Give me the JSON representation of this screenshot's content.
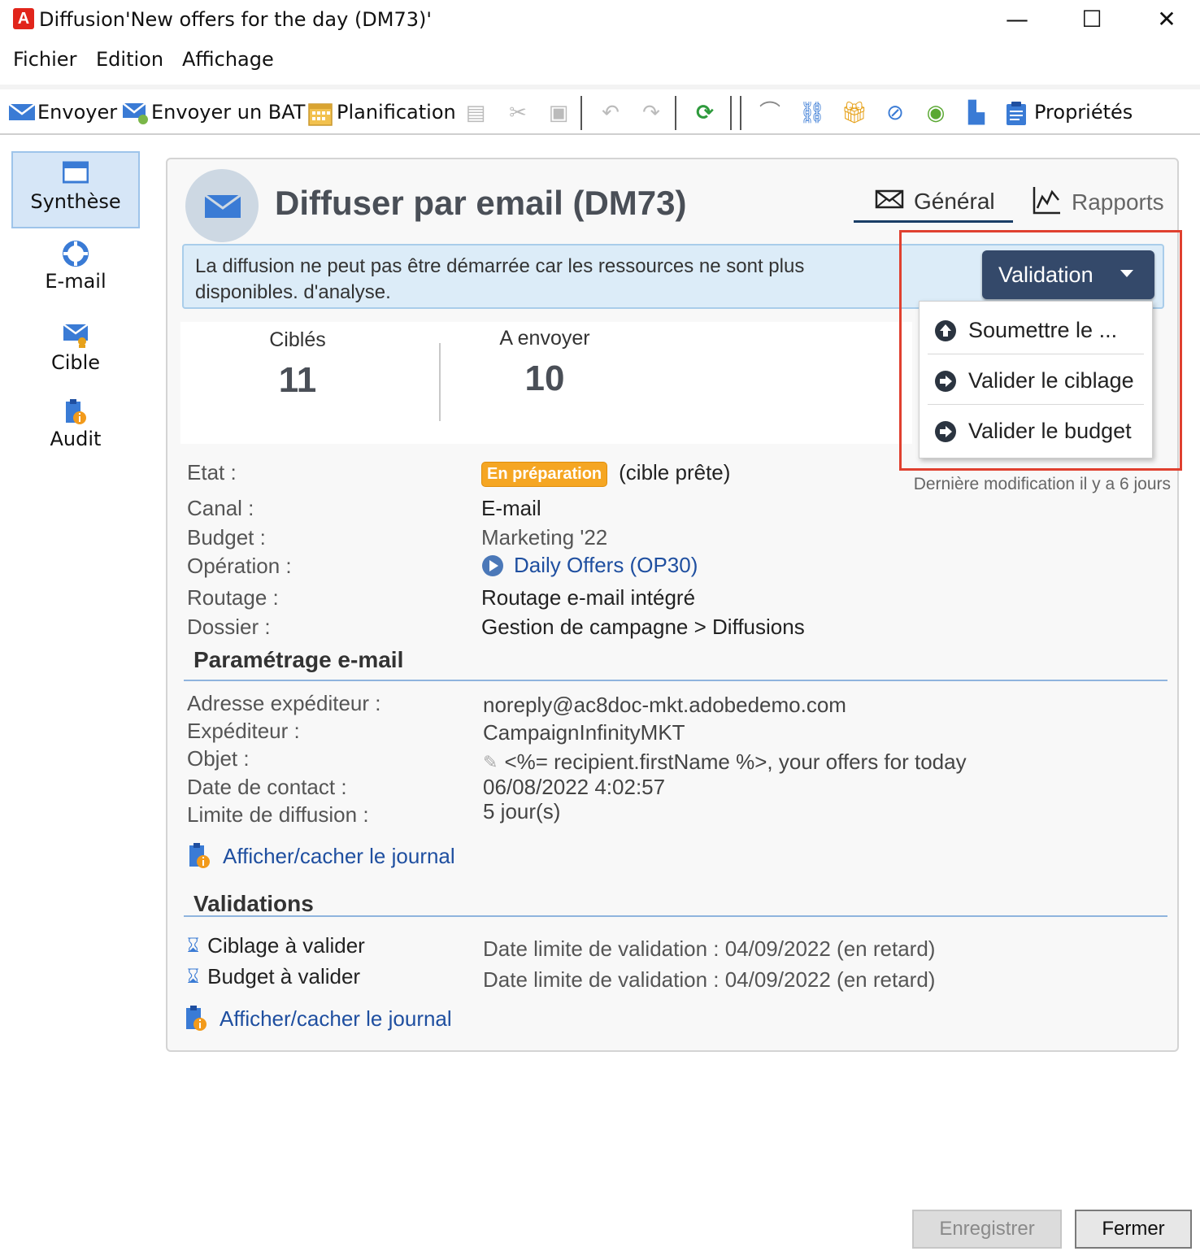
{
  "window": {
    "title_prefix": "Diffusion",
    "title": "'New offers for the day (DM73)'",
    "minimize": "—",
    "maximize": "☐",
    "close": "✕"
  },
  "menu": [
    "Fichier",
    "Edition",
    "Affichage"
  ],
  "toolbar": {
    "send": "Envoyer",
    "send_proof": "Envoyer un BAT",
    "schedule": "Planification",
    "properties": "Propriétés"
  },
  "sidebar": {
    "items": [
      {
        "label": "Synthèse",
        "icon": "summary-icon"
      },
      {
        "label": "E-mail",
        "icon": "email-icon"
      },
      {
        "label": "Cible",
        "icon": "target-icon"
      },
      {
        "label": "Audit",
        "icon": "audit-icon"
      }
    ]
  },
  "header": {
    "title": "Diffuser par email (DM73)",
    "tabs": [
      "Général",
      "Rapports"
    ]
  },
  "alert": {
    "text": "La diffusion ne peut pas être démarrée car les ressources ne sont plus disponibles. d'analyse.",
    "button": "Validation"
  },
  "dropdown": {
    "items": [
      "Soumettre le ...",
      "Valider le ciblage",
      "Valider le budget"
    ]
  },
  "stats": {
    "targeted_label": "Ciblés",
    "targeted_value": "11",
    "to_send_label": "A envoyer",
    "to_send_value": "10"
  },
  "details": {
    "etat_label": "Etat :",
    "etat_badge": "En préparation",
    "etat_value": "(cible prête)",
    "last_modified": "Dernière modification il y a 6 jours",
    "canal_label": "Canal :",
    "canal_value": "E-mail",
    "budget_label": "Budget :",
    "budget_value": "Marketing '22",
    "operation_label": "Opération :",
    "operation_value": "Daily Offers (OP30)",
    "routage_label": "Routage :",
    "routage_value": "Routage e-mail  intégré",
    "dossier_label": "Dossier :",
    "dossier_value": "Gestion de campagne > Diffusions"
  },
  "email_settings": {
    "title": "Paramétrage e-mail",
    "from_address_label": "Adresse expéditeur :",
    "from_address_value": "noreply@ac8doc-mkt.adobedemo.com",
    "from_label": "Expéditeur :",
    "from_value": "CampaignInfinityMKT",
    "subject_label": "Objet :",
    "subject_value": "<%= recipient.firstName %>, your offers for today",
    "contact_date_label": "Date de contact :",
    "contact_date_value": "06/08/2022 4:02:57",
    "limit_label": "Limite de diffusion :",
    "limit_value": "5 jour(s)",
    "journal_link": "Afficher/cacher le journal"
  },
  "validations": {
    "title": "Validations",
    "items": [
      {
        "label": "Ciblage à valider",
        "deadline": "Date limite de validation : 04/09/2022 (en retard)"
      },
      {
        "label": "Budget à valider",
        "deadline": "Date limite de validation : 04/09/2022 (en retard)"
      }
    ],
    "journal_link": "Afficher/cacher le journal"
  },
  "footer": {
    "save": "Enregistrer",
    "close": "Fermer"
  },
  "colors": {
    "accent": "#34496a",
    "badge": "#f5a623",
    "link": "#1f4fa0",
    "highlight": "#e0402f"
  }
}
